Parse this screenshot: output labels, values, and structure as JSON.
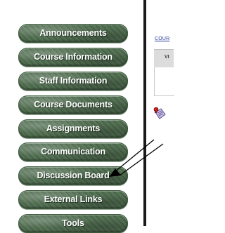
{
  "nav": {
    "items": [
      {
        "label": "Announcements"
      },
      {
        "label": "Course Information"
      },
      {
        "label": "Staff Information"
      },
      {
        "label": "Course Documents"
      },
      {
        "label": "Assignments"
      },
      {
        "label": "Communication"
      },
      {
        "label": "Discussion Board"
      },
      {
        "label": "External Links"
      },
      {
        "label": "Tools"
      }
    ]
  },
  "main": {
    "breadcrumb": "COUR",
    "tab_label": "VI",
    "item_icon": "assignment-document-icon"
  },
  "annotation": {
    "arrow_icon": "arrow-pointer-icon",
    "color": "#000000"
  }
}
